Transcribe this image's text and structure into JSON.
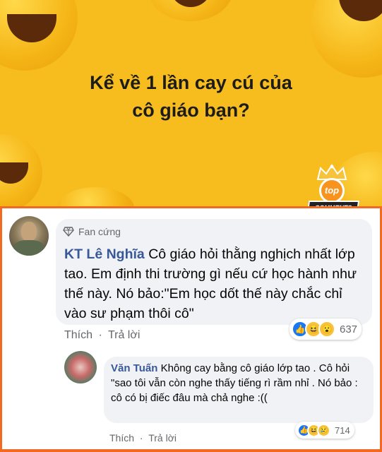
{
  "banner": {
    "title_line1": "Kể về 1 lần cay cú của",
    "title_line2": "cô giáo bạn?",
    "badge_top": "top",
    "badge_bottom": "COMMENTS",
    "bg_color": "#f7bc1d"
  },
  "comment": {
    "fan_badge": "Fan cứng",
    "author": "KT Lê Nghĩa",
    "text": "Cô giáo hỏi thằng nghịch nhất lớp tao. Em định thi trường gì nếu cứ học hành như thế này. Nó bảo:\"Em học dốt thế này chắc chỉ vào sư phạm thôi cô\"",
    "like_label": "Thích",
    "reply_label": "Trả lời",
    "reaction_icons": [
      "like-icon",
      "haha-icon",
      "wow-icon"
    ],
    "reaction_count": "637"
  },
  "reply": {
    "author": "Văn Tuấn",
    "text": "Không cay bằng cô giáo lớp tao . Cô hỏi \"sao tôi vẫn còn nghe thấy tiếng rì rầm nhỉ . Nó bảo : cô có bị điếc đâu mà chả nghe :((",
    "like_label": "Thích",
    "reply_label": "Trả lời",
    "reaction_icons": [
      "like-icon",
      "haha-icon",
      "sad-icon"
    ],
    "reaction_count": "714"
  },
  "separator": "·",
  "colors": {
    "frame_border": "#f26a21",
    "author_link": "#385898",
    "like_blue": "#1877f2"
  }
}
